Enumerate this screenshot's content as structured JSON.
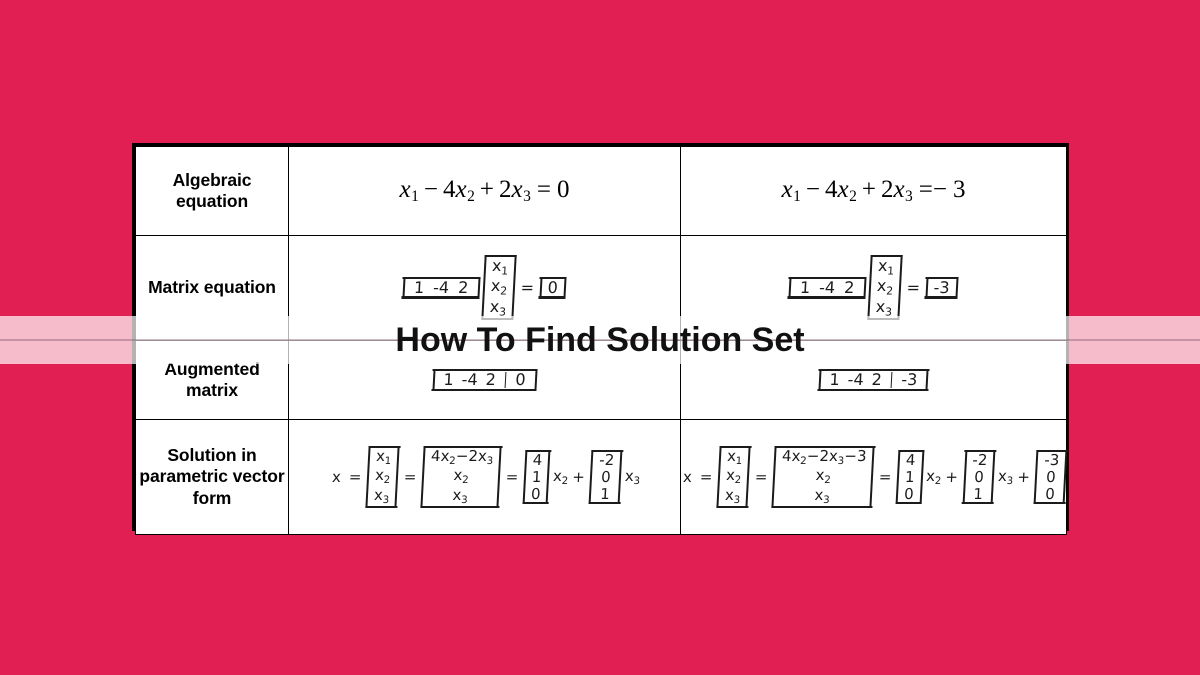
{
  "page": {
    "background_color": "#e21f52",
    "banner_text_color": "#111111",
    "banner_tint_color": "#ffffff"
  },
  "overlay": {
    "title": "How To Find Solution Set"
  },
  "table": {
    "row_labels": [
      "Algebraic equation",
      "Matrix equation",
      "Augmented matrix",
      "Solution in parametric vector form"
    ],
    "rows": [
      {
        "label": "Algebraic equation",
        "left": {
          "terms": [
            "x",
            "1",
            "–",
            "4",
            "x",
            "2",
            "+",
            "2",
            "x",
            "3",
            "=",
            "0"
          ],
          "plain": "x1 – 4x2 + 2x3 = 0"
        },
        "right": {
          "terms": [
            "x",
            "1",
            "–",
            "4",
            "x",
            "2",
            "+",
            "2",
            "x",
            "3",
            "=–",
            "3"
          ],
          "plain": "x1 – 4x2 + 2x3 =– 3"
        }
      },
      {
        "label": "Matrix equation",
        "left": {
          "coeff_row": [
            "1",
            "-4",
            "2"
          ],
          "unknowns": [
            "x1",
            "x2",
            "x3"
          ],
          "equals": "=",
          "rhs": [
            "0"
          ],
          "plain": "[1 -4 2][x1 x2 x3]^T = [0]"
        },
        "right": {
          "coeff_row": [
            "1",
            "-4",
            "2"
          ],
          "unknowns": [
            "x1",
            "x2",
            "x3"
          ],
          "equals": "=",
          "rhs": [
            "-3"
          ],
          "plain": "[1 -4 2][x1 x2 x3]^T = [-3]"
        }
      },
      {
        "label": "Augmented matrix",
        "left": {
          "coeffs": [
            "1",
            "-4",
            "2"
          ],
          "augment": [
            "0"
          ],
          "plain": "[1 -4 2 | 0]"
        },
        "right": {
          "coeffs": [
            "1",
            "-4",
            "2"
          ],
          "augment": [
            "-3"
          ],
          "plain": "[1 -4 2 | -3]"
        }
      },
      {
        "label": "Solution in parametric vector form",
        "left": {
          "x_label": "x",
          "eq1": "=",
          "vector_x": [
            "x1",
            "x2",
            "x3"
          ],
          "eq2": "=",
          "expanded": [
            "4x2 – 2x3",
            "x2",
            "x3"
          ],
          "eq3": "=",
          "basis1": [
            "4",
            "1",
            "0"
          ],
          "scalar1": "x2",
          "plus1": "+",
          "basis2": [
            "-2",
            "0",
            "1"
          ],
          "scalar2": "x3",
          "plain": "x = [x1 x2 x3] = [4x2-2x3, x2, x3] = [4 1 0] x2 + [-2 0 1] x3"
        },
        "right": {
          "x_label": "x",
          "eq1": "=",
          "vector_x": [
            "x1",
            "x2",
            "x3"
          ],
          "eq2": "=",
          "expanded": [
            "4x2 – 2x3 – 3",
            "x2",
            "x3"
          ],
          "eq3": "=",
          "basis1": [
            "4",
            "1",
            "0"
          ],
          "scalar1": "x2",
          "plus1": "+",
          "basis2": [
            "-2",
            "0",
            "1"
          ],
          "scalar2": "x3",
          "plus2": "+",
          "basis3": [
            "-3",
            "0",
            "0"
          ],
          "plain": "x = [x1 x2 x3] = [4x2-2x3-3, x2, x3] = [4 1 0] x2 + [-2 0 1] x3 + [-3 0 0]"
        }
      }
    ]
  }
}
